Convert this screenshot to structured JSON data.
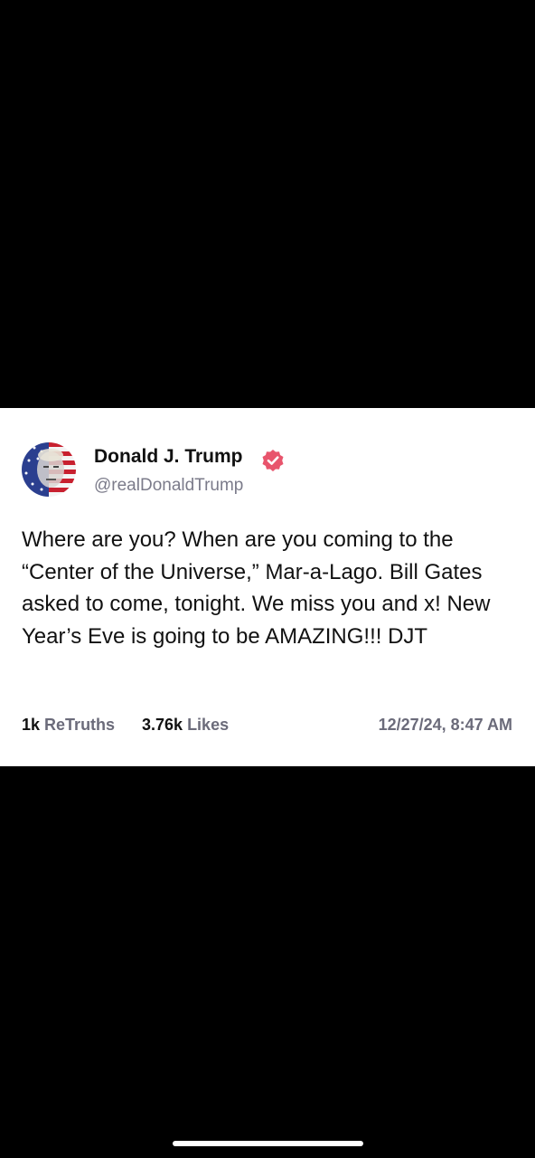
{
  "post": {
    "author_name": "Donald J. Trump",
    "handle": "@realDonaldTrump",
    "verified": true,
    "verified_icon": "verified-badge-icon",
    "verified_color": "#e8546c",
    "avatar_icon": "flag-portrait-avatar",
    "text": "Where are you? When are you coming to the “Center of the Universe,” Mar-a-Lago. Bill Gates asked to come, tonight. We miss you and x! New Year’s Eve is going to be AMAZING!!! DJT",
    "retruths_count": "1k",
    "retruths_label": "ReTruths",
    "likes_count": "3.76k",
    "likes_label": "Likes",
    "timestamp": "12/27/24, 8:47 AM"
  },
  "colors": {
    "background": "#000000",
    "card": "#ffffff",
    "text": "#111111",
    "muted": "#6b6b7a"
  }
}
